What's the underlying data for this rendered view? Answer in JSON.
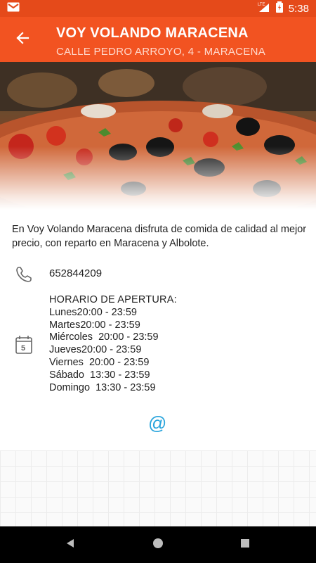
{
  "status_bar": {
    "time": "5:38",
    "network": "LTE",
    "icons": [
      "gmail-icon",
      "lte-signal-icon",
      "battery-charging-icon"
    ]
  },
  "app_bar": {
    "title": "VOY VOLANDO MARACENA",
    "subtitle": "CALLE PEDRO ARROYO, 4 - MARACENA",
    "back_icon": "arrow-left-icon"
  },
  "hero": {
    "image": "pizza-photo"
  },
  "description": "En Voy Volando Maracena disfruta de comida de calidad al mejor precio, con reparto en Maracena y Albolote.",
  "phone": {
    "icon": "phone-icon",
    "number": "652844209"
  },
  "hours": {
    "icon": "calendar-icon",
    "title": "HORARIO DE APERTURA:",
    "rows": [
      "Lunes20:00 - 23:59",
      "Martes20:00 - 23:59",
      "Miércoles  20:00 - 23:59",
      "Jueves20:00 - 23:59",
      "Viernes  20:00 - 23:59",
      "Sábado  13:30 - 23:59",
      "Domingo  13:30 - 23:59"
    ]
  },
  "email": {
    "label": "@",
    "color": "#28a4dc"
  },
  "colors": {
    "accent": "#f25321",
    "status_bar": "#e54a1a",
    "link": "#28a4dc"
  },
  "nav": {
    "icons": [
      "back-triangle-icon",
      "home-circle-icon",
      "recents-square-icon"
    ]
  }
}
